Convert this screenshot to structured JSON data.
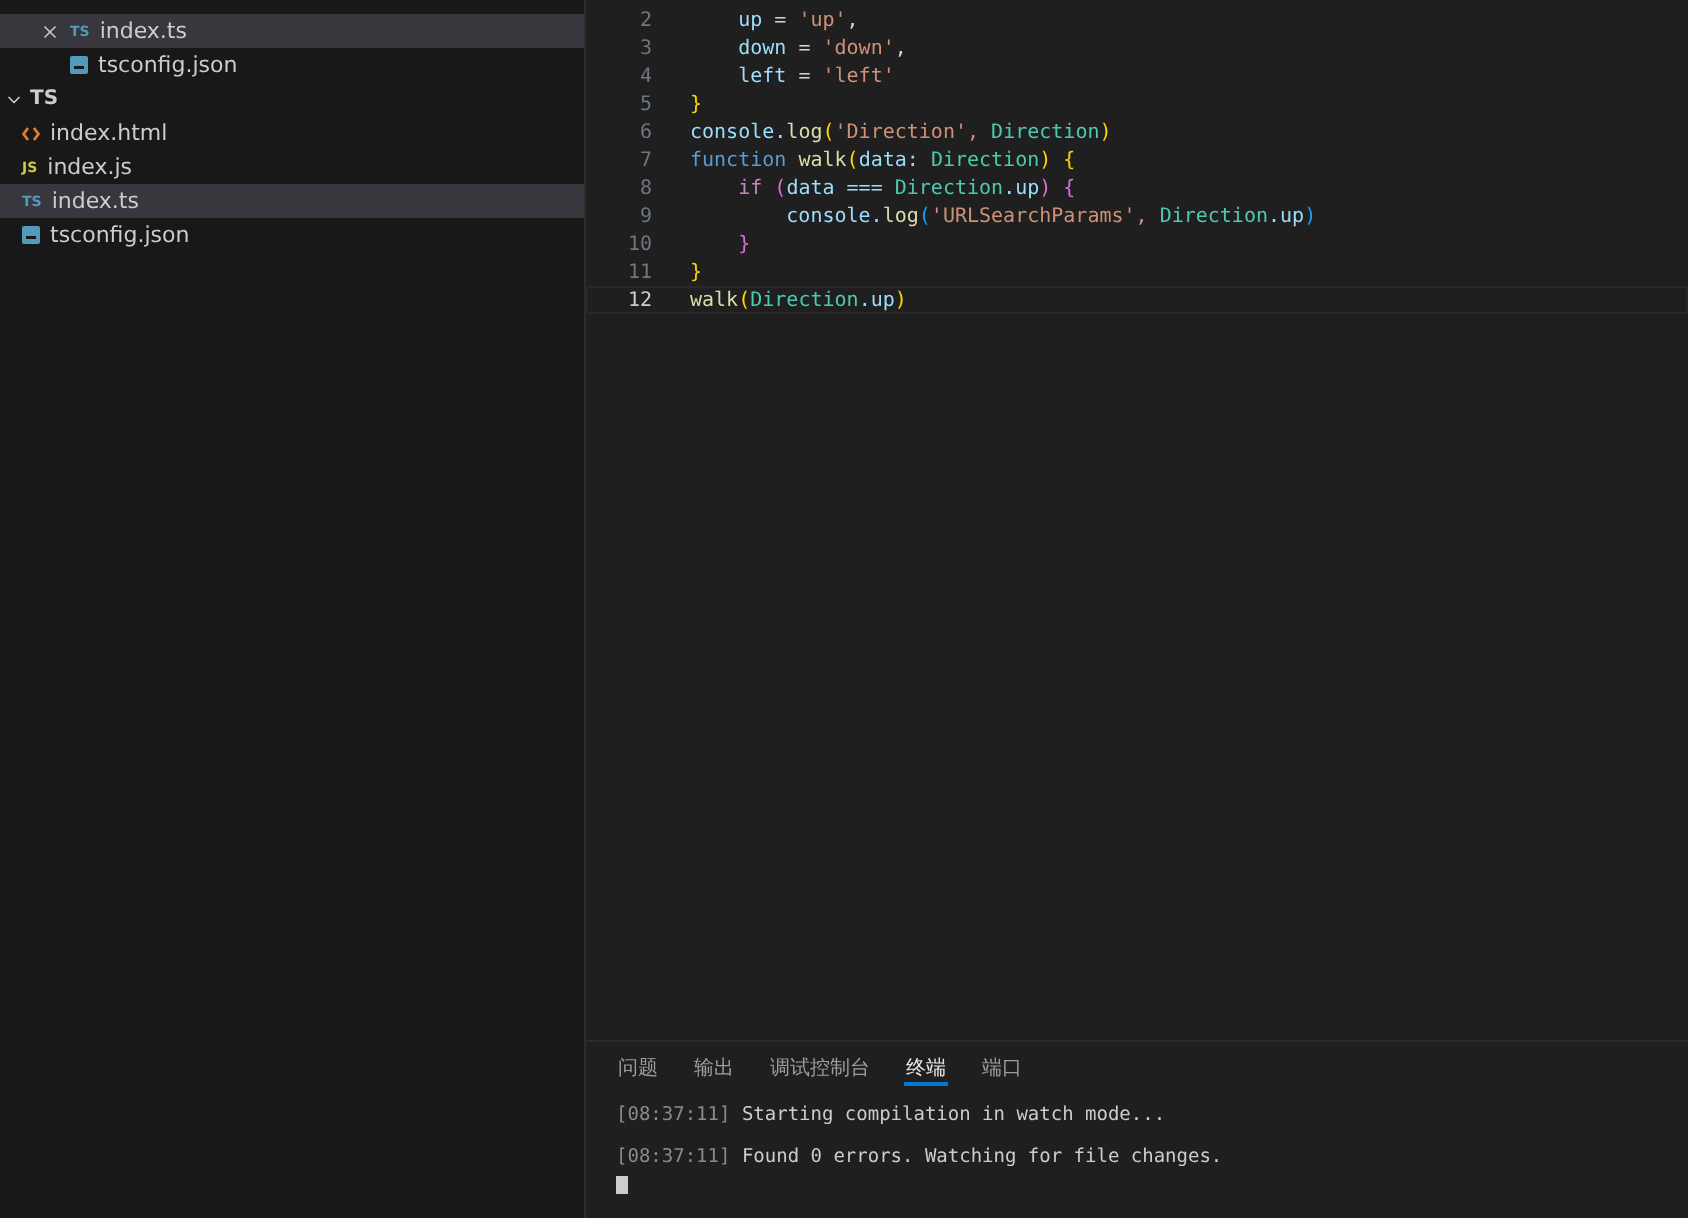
{
  "sidebar": {
    "open_editors": [
      {
        "name": "index.ts",
        "kind": "ts",
        "badge": "TS",
        "selected": true,
        "closable": true
      },
      {
        "name": "tsconfig.json",
        "kind": "json",
        "selected": false,
        "closable": false
      }
    ],
    "folder": {
      "name": "TS",
      "expanded": true,
      "items": [
        {
          "name": "index.html",
          "kind": "html",
          "selected": false
        },
        {
          "name": "index.js",
          "kind": "js",
          "badge": "JS",
          "selected": false
        },
        {
          "name": "index.ts",
          "kind": "ts",
          "badge": "TS",
          "selected": true
        },
        {
          "name": "tsconfig.json",
          "kind": "json",
          "selected": false
        }
      ]
    }
  },
  "editor": {
    "lines": [
      {
        "number": "2",
        "current": false,
        "tokens": [
          {
            "t": "    up",
            "color": "#9cdcfe"
          },
          {
            "t": " = ",
            "color": "#d4d4d4"
          },
          {
            "t": "'up'",
            "color": "#ce9178"
          },
          {
            "t": ",",
            "color": "#d4d4d4"
          }
        ]
      },
      {
        "number": "3",
        "current": false,
        "tokens": [
          {
            "t": "    down",
            "color": "#9cdcfe"
          },
          {
            "t": " = ",
            "color": "#d4d4d4"
          },
          {
            "t": "'down'",
            "color": "#ce9178"
          },
          {
            "t": ",",
            "color": "#d4d4d4"
          }
        ]
      },
      {
        "number": "4",
        "current": false,
        "tokens": [
          {
            "t": "    left",
            "color": "#9cdcfe"
          },
          {
            "t": " = ",
            "color": "#d4d4d4"
          },
          {
            "t": "'left'",
            "color": "#ce9178"
          }
        ]
      },
      {
        "number": "5",
        "current": false,
        "tokens": [
          {
            "t": "}",
            "color": "#ffd700"
          }
        ]
      },
      {
        "number": "6",
        "current": false,
        "tokens": [
          {
            "t": "console.",
            "color": "#9cdcfe"
          },
          {
            "t": "log",
            "color": "#dcdcaa"
          },
          {
            "t": "(",
            "color": "#ffd700"
          },
          {
            "t": "'Direction', ",
            "color": "#ce9178"
          },
          {
            "t": "Direction",
            "color": "#4ec9b0"
          },
          {
            "t": ")",
            "color": "#ffd700"
          }
        ]
      },
      {
        "number": "7",
        "current": false,
        "tokens": [
          {
            "t": "function ",
            "color": "#569cd6"
          },
          {
            "t": "walk",
            "color": "#dcdcaa"
          },
          {
            "t": "(",
            "color": "#ffd700"
          },
          {
            "t": "data: ",
            "color": "#9cdcfe"
          },
          {
            "t": "Direction",
            "color": "#4ec9b0"
          },
          {
            "t": ") {",
            "color": "#ffd700"
          }
        ]
      },
      {
        "number": "8",
        "current": false,
        "tokens": [
          {
            "t": "    if ",
            "color": "#c586c0"
          },
          {
            "t": "(",
            "color": "#da70d6"
          },
          {
            "t": "data === ",
            "color": "#9cdcfe"
          },
          {
            "t": "Direction",
            "color": "#4ec9b0"
          },
          {
            "t": ".up",
            "color": "#9cdcfe"
          },
          {
            "t": ") {",
            "color": "#da70d6"
          }
        ]
      },
      {
        "number": "9",
        "current": false,
        "tokens": [
          {
            "t": "        console.",
            "color": "#9cdcfe"
          },
          {
            "t": "log",
            "color": "#dcdcaa"
          },
          {
            "t": "(",
            "color": "#179fff"
          },
          {
            "t": "'URLSearchParams', ",
            "color": "#ce9178"
          },
          {
            "t": "Direction",
            "color": "#4ec9b0"
          },
          {
            "t": ".up",
            "color": "#9cdcfe"
          },
          {
            "t": ")",
            "color": "#179fff"
          }
        ]
      },
      {
        "number": "10",
        "current": false,
        "tokens": [
          {
            "t": "    }",
            "color": "#da70d6"
          }
        ]
      },
      {
        "number": "11",
        "current": false,
        "tokens": [
          {
            "t": "}",
            "color": "#ffd700"
          }
        ]
      },
      {
        "number": "12",
        "current": true,
        "tokens": [
          {
            "t": "walk",
            "color": "#dcdcaa"
          },
          {
            "t": "(",
            "color": "#ffd700"
          },
          {
            "t": "Direction",
            "color": "#4ec9b0"
          },
          {
            "t": ".up",
            "color": "#9cdcfe"
          },
          {
            "t": ")",
            "color": "#ffd700"
          }
        ]
      }
    ]
  },
  "panel": {
    "tabs": [
      {
        "label": "问题",
        "selected": false
      },
      {
        "label": "输出",
        "selected": false
      },
      {
        "label": "调试控制台",
        "selected": false
      },
      {
        "label": "终端",
        "selected": true
      },
      {
        "label": "端口",
        "selected": false
      }
    ],
    "terminal": [
      {
        "time": "[08:37:11]",
        "text": "Starting compilation in watch mode..."
      },
      {
        "time": "[08:37:11]",
        "text": "Found 0 errors. Watching for file changes."
      }
    ]
  }
}
